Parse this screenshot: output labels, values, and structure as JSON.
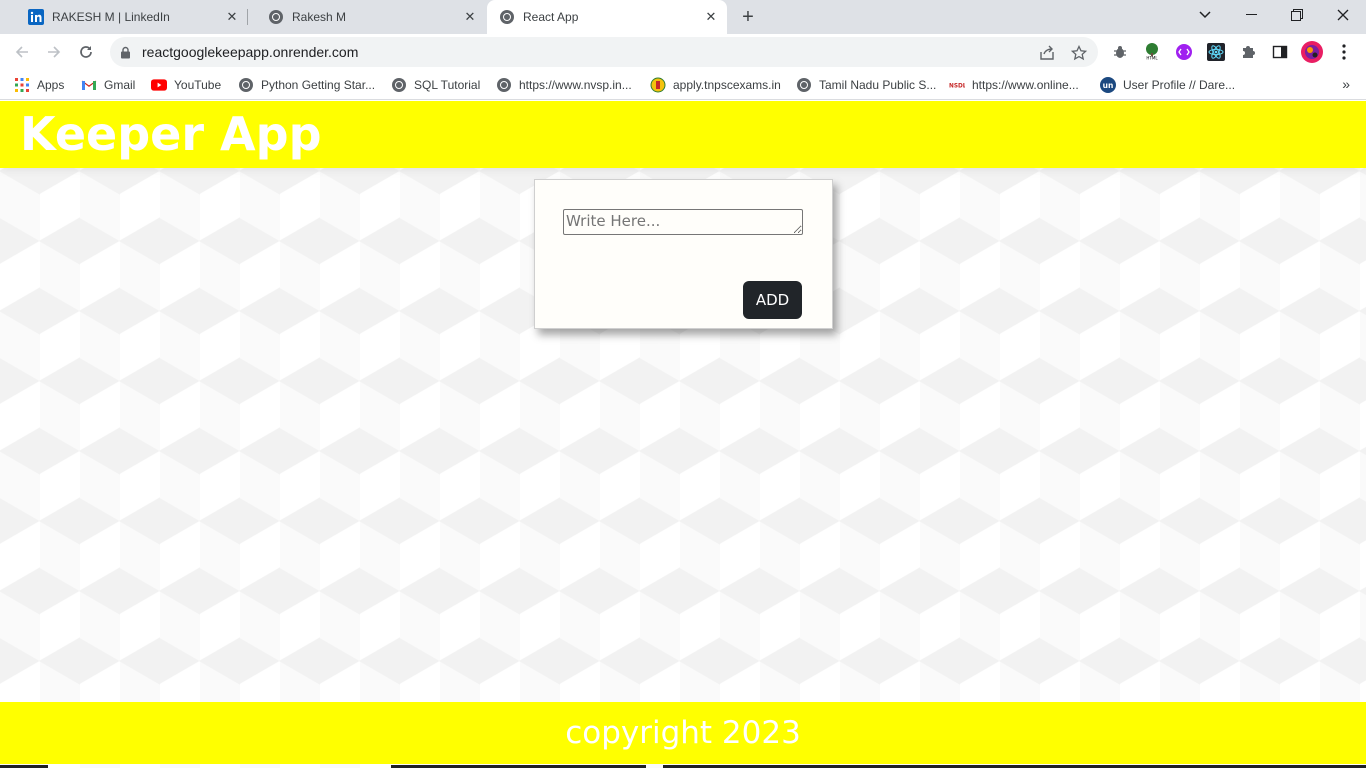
{
  "browser": {
    "tabs": [
      {
        "title": "RAKESH M | LinkedIn",
        "icon": "linkedin-icon",
        "active": false
      },
      {
        "title": "Rakesh M",
        "icon": "globe-icon",
        "active": false
      },
      {
        "title": "React App",
        "icon": "globe-icon",
        "active": true
      }
    ],
    "url": "reactgooglekeepapp.onrender.com",
    "bookmarks": [
      {
        "label": "Apps",
        "icon": "apps-grid-icon"
      },
      {
        "label": "Gmail",
        "icon": "gmail-icon"
      },
      {
        "label": "YouTube",
        "icon": "youtube-icon"
      },
      {
        "label": "Python Getting Star...",
        "icon": "globe-icon"
      },
      {
        "label": "SQL Tutorial",
        "icon": "globe-icon"
      },
      {
        "label": "https://www.nvsp.in...",
        "icon": "globe-icon"
      },
      {
        "label": "apply.tnpscexams.in",
        "icon": "tnpsc-emblem-icon"
      },
      {
        "label": "Tamil Nadu Public S...",
        "icon": "globe-icon"
      },
      {
        "label": "https://www.online...",
        "icon": "nsdl-icon"
      },
      {
        "label": "User Profile // Dare...",
        "icon": "unstop-icon"
      }
    ],
    "more_bookmarks": "»",
    "accent": "#1a73e8"
  },
  "app": {
    "title": "Keeper App",
    "header_color": "#ffff00",
    "note_placeholder": "Write Here...",
    "note_value": "",
    "add_label": "ADD",
    "footer": "copyright 2023"
  }
}
